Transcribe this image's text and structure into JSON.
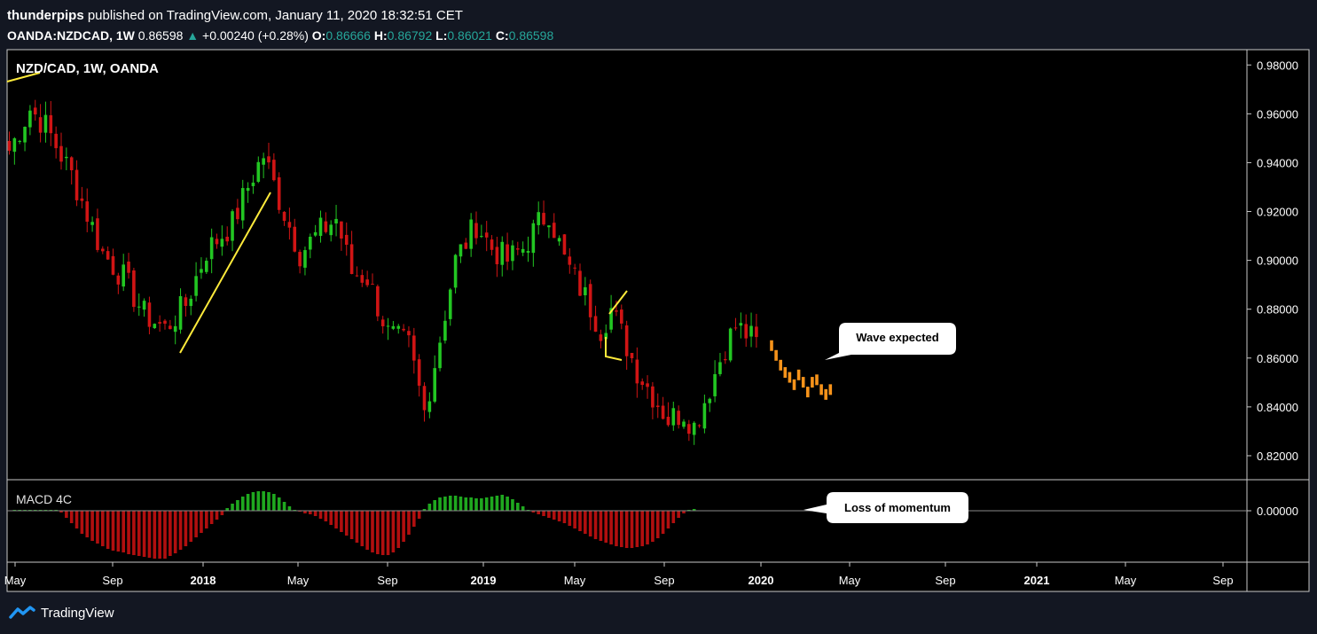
{
  "header": {
    "author": "thunderpips",
    "published_text": "published on TradingView.com, January 11, 2020 18:32:51 CET",
    "symbol_interval": "OANDA:NZDCAD, 1W",
    "last_price": "0.86598",
    "change": "+0.00240 (+0.28%)",
    "o_label": "O:",
    "o_value": "0.86666",
    "h_label": "H:",
    "h_value": "0.86792",
    "l_label": "L:",
    "l_value": "0.86021",
    "c_label": "C:",
    "c_value": "0.86598"
  },
  "pane_title": "NZD/CAD, 1W, OANDA",
  "macd_title": "MACD 4C",
  "footer": {
    "brand": "TradingView"
  },
  "colors": {
    "background": "#000000",
    "up": "#22c622",
    "down": "#d01414",
    "projection": "#f7931a",
    "trendline": "#ffeb3b",
    "macd_up": "#1fa81f",
    "macd_down": "#b10f0f"
  },
  "annotations": {
    "wave_label": "Wave expected",
    "momentum_label": "Loss of momentum"
  },
  "chart_data": {
    "type": "candlestick",
    "title": "NZD/CAD, 1W, OANDA",
    "y_price_range": [
      0.812,
      0.983
    ],
    "price_ticks": [
      "0.98000",
      "0.96000",
      "0.94000",
      "0.92000",
      "0.90000",
      "0.88000",
      "0.86000",
      "0.84000",
      "0.82000"
    ],
    "macd_ticks": [
      "0.00000"
    ],
    "x_ticks": [
      "May",
      "Sep",
      "2018",
      "May",
      "Sep",
      "2019",
      "May",
      "Sep",
      "2020",
      "May",
      "Sep",
      "2021",
      "May",
      "Sep"
    ],
    "price_anchors": [
      [
        0,
        0.945
      ],
      [
        4,
        0.962
      ],
      [
        7,
        0.955
      ],
      [
        12,
        0.935
      ],
      [
        18,
        0.903
      ],
      [
        22,
        0.893
      ],
      [
        26,
        0.878
      ],
      [
        30,
        0.872
      ],
      [
        34,
        0.882
      ],
      [
        38,
        0.904
      ],
      [
        43,
        0.915
      ],
      [
        47,
        0.935
      ],
      [
        49,
        0.943
      ],
      [
        52,
        0.925
      ],
      [
        56,
        0.903
      ],
      [
        60,
        0.912
      ],
      [
        63,
        0.917
      ],
      [
        66,
        0.895
      ],
      [
        69,
        0.893
      ],
      [
        73,
        0.87
      ],
      [
        77,
        0.865
      ],
      [
        80,
        0.838
      ],
      [
        83,
        0.868
      ],
      [
        86,
        0.9
      ],
      [
        90,
        0.915
      ],
      [
        93,
        0.905
      ],
      [
        96,
        0.9
      ],
      [
        99,
        0.905
      ],
      [
        102,
        0.915
      ],
      [
        104,
        0.92
      ],
      [
        107,
        0.9
      ],
      [
        111,
        0.885
      ],
      [
        114,
        0.872
      ],
      [
        116,
        0.88
      ],
      [
        118,
        0.87
      ],
      [
        121,
        0.855
      ],
      [
        124,
        0.845
      ],
      [
        127,
        0.835
      ],
      [
        130,
        0.838
      ],
      [
        132,
        0.832
      ],
      [
        135,
        0.848
      ],
      [
        138,
        0.865
      ],
      [
        140,
        0.873
      ],
      [
        142,
        0.87
      ],
      [
        144,
        0.866
      ]
    ],
    "projection_bars": [
      0.864,
      0.86,
      0.856,
      0.853,
      0.851,
      0.848,
      0.852,
      0.849,
      0.845,
      0.849,
      0.85,
      0.846,
      0.844,
      0.846
    ],
    "macd": {
      "values": [
        0.001,
        0.001,
        0.001,
        0.001,
        0.001,
        0.001,
        0.001,
        0.001,
        0.001,
        -0.002,
        -0.008,
        -0.014,
        -0.02,
        -0.026,
        -0.03,
        -0.034,
        -0.037,
        -0.04,
        -0.043,
        -0.045,
        -0.046,
        -0.047,
        -0.049,
        -0.05,
        -0.051,
        -0.052,
        -0.053,
        -0.054,
        -0.054,
        -0.054,
        -0.051,
        -0.048,
        -0.044,
        -0.04,
        -0.035,
        -0.03,
        -0.025,
        -0.02,
        -0.015,
        -0.01,
        -0.005,
        0.003,
        0.008,
        0.012,
        0.016,
        0.019,
        0.021,
        0.022,
        0.022,
        0.021,
        0.019,
        0.015,
        0.01,
        0.005,
        0.001,
        -0.001,
        -0.003,
        -0.004,
        -0.006,
        -0.009,
        -0.012,
        -0.016,
        -0.02,
        -0.024,
        -0.028,
        -0.032,
        -0.036,
        -0.04,
        -0.044,
        -0.047,
        -0.049,
        -0.05,
        -0.05,
        -0.047,
        -0.042,
        -0.035,
        -0.027,
        -0.018,
        -0.009,
        0.002,
        0.008,
        0.012,
        0.015,
        0.016,
        0.017,
        0.017,
        0.016,
        0.015,
        0.015,
        0.014,
        0.014,
        0.015,
        0.016,
        0.017,
        0.018,
        0.016,
        0.013,
        0.009,
        0.005,
        0.001,
        -0.002,
        -0.004,
        -0.006,
        -0.008,
        -0.01,
        -0.012,
        -0.014,
        -0.017,
        -0.02,
        -0.023,
        -0.026,
        -0.029,
        -0.032,
        -0.034,
        -0.036,
        -0.038,
        -0.04,
        -0.041,
        -0.042,
        -0.042,
        -0.041,
        -0.04,
        -0.038,
        -0.035,
        -0.031,
        -0.026,
        -0.02,
        -0.014,
        -0.008,
        -0.003,
        0.001,
        0.002
      ]
    }
  }
}
